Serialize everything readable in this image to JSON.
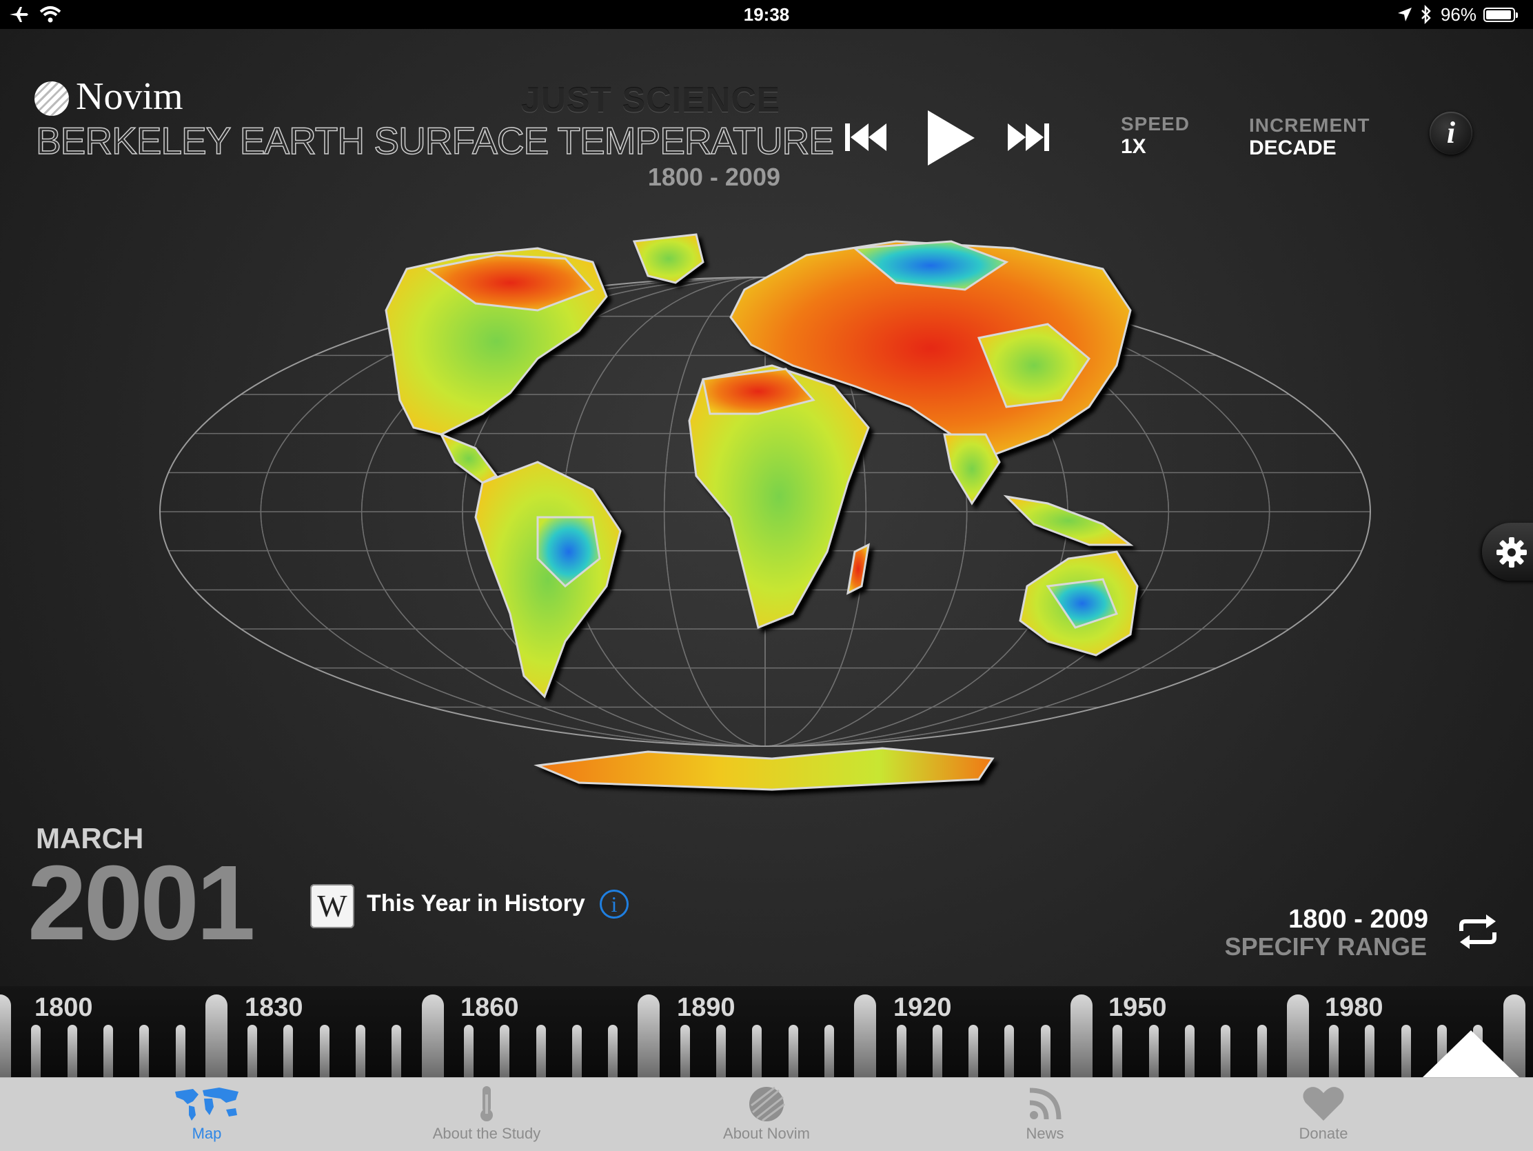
{
  "status_bar": {
    "time": "19:38",
    "battery_percent": "96%",
    "battery_level": 0.96,
    "icons": [
      "airplane-icon",
      "wifi-icon",
      "location-arrow-icon",
      "bluetooth-icon",
      "battery-icon"
    ]
  },
  "header": {
    "brand": "Novim",
    "tagline": "JUST SCIENCE",
    "title": "BERKELEY EARTH SURFACE TEMPERATURE",
    "year_range": "1800 - 2009"
  },
  "playback": {
    "speed_label": "SPEED",
    "speed_value": "1X",
    "increment_label": "INCREMENT",
    "increment_value": "DECADE",
    "icons": [
      "skip-back-icon",
      "play-icon",
      "skip-forward-icon",
      "info-icon"
    ]
  },
  "map": {
    "projection": "mollweide",
    "color_scale": [
      "#1e6ee8",
      "#2ec8c8",
      "#c8e632",
      "#f0c81e",
      "#f07814",
      "#e62814"
    ]
  },
  "date": {
    "month": "MARCH",
    "year": "2001"
  },
  "history": {
    "wiki_glyph": "W",
    "label": "This Year in History",
    "info_glyph": "i"
  },
  "range": {
    "value": "1800 - 2009",
    "label": "SPECIFY RANGE"
  },
  "timeline": {
    "labels": [
      "1800",
      "1830",
      "1860",
      "1890",
      "1920",
      "1950",
      "1980"
    ]
  },
  "tabs": [
    {
      "label": "Map",
      "icon": "world-map-icon",
      "active": true
    },
    {
      "label": "About the Study",
      "icon": "thermometer-icon",
      "active": false
    },
    {
      "label": "About Novim",
      "icon": "novim-globe-icon",
      "active": false
    },
    {
      "label": "News",
      "icon": "rss-icon",
      "active": false
    },
    {
      "label": "Donate",
      "icon": "heart-icon",
      "active": false
    }
  ],
  "colors": {
    "accent": "#2e86e6",
    "tab_bar": "#cfcfcf",
    "inactive_tab": "#8c8c8c"
  }
}
